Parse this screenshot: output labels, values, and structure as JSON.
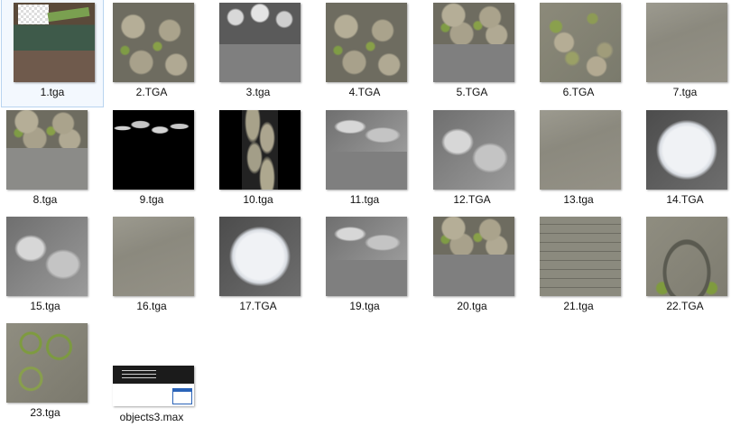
{
  "files": [
    {
      "label": "1.tga",
      "selected": true
    },
    {
      "label": "2.TGA"
    },
    {
      "label": "3.tga"
    },
    {
      "label": "4.TGA"
    },
    {
      "label": "5.TGA"
    },
    {
      "label": "6.TGA"
    },
    {
      "label": "7.tga"
    },
    {
      "label": "8.tga"
    },
    {
      "label": "9.tga"
    },
    {
      "label": "10.tga"
    },
    {
      "label": "11.tga"
    },
    {
      "label": "12.TGA"
    },
    {
      "label": "13.tga"
    },
    {
      "label": "14.TGA"
    },
    {
      "label": "15.tga"
    },
    {
      "label": "16.tga"
    },
    {
      "label": "17.TGA"
    },
    {
      "label": "19.tga"
    },
    {
      "label": "20.tga"
    },
    {
      "label": "21.tga"
    },
    {
      "label": "22.TGA"
    },
    {
      "label": "23.tga"
    },
    {
      "label": "objects3.max",
      "icon": "3ds-max-file-icon"
    }
  ],
  "colors": {
    "selection_bg": "#f3f8fe",
    "selection_border": "#b9d4f0",
    "label_text": "#111111",
    "background": "#ffffff"
  }
}
